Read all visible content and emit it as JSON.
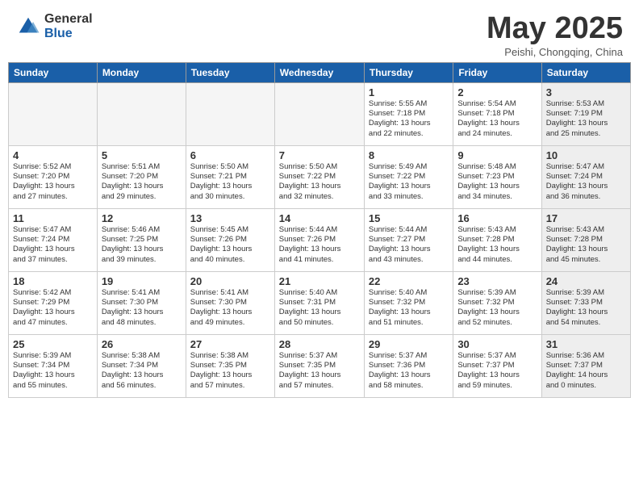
{
  "logo": {
    "general": "General",
    "blue": "Blue"
  },
  "title": {
    "month": "May 2025",
    "location": "Peishi, Chongqing, China"
  },
  "days": [
    "Sunday",
    "Monday",
    "Tuesday",
    "Wednesday",
    "Thursday",
    "Friday",
    "Saturday"
  ],
  "weeks": [
    [
      {
        "day": "",
        "empty": true
      },
      {
        "day": "",
        "empty": true
      },
      {
        "day": "",
        "empty": true
      },
      {
        "day": "",
        "empty": true
      },
      {
        "day": "1",
        "lines": [
          "Sunrise: 5:55 AM",
          "Sunset: 7:18 PM",
          "Daylight: 13 hours",
          "and 22 minutes."
        ]
      },
      {
        "day": "2",
        "lines": [
          "Sunrise: 5:54 AM",
          "Sunset: 7:18 PM",
          "Daylight: 13 hours",
          "and 24 minutes."
        ]
      },
      {
        "day": "3",
        "shaded": true,
        "lines": [
          "Sunrise: 5:53 AM",
          "Sunset: 7:19 PM",
          "Daylight: 13 hours",
          "and 25 minutes."
        ]
      }
    ],
    [
      {
        "day": "4",
        "lines": [
          "Sunrise: 5:52 AM",
          "Sunset: 7:20 PM",
          "Daylight: 13 hours",
          "and 27 minutes."
        ]
      },
      {
        "day": "5",
        "lines": [
          "Sunrise: 5:51 AM",
          "Sunset: 7:20 PM",
          "Daylight: 13 hours",
          "and 29 minutes."
        ]
      },
      {
        "day": "6",
        "lines": [
          "Sunrise: 5:50 AM",
          "Sunset: 7:21 PM",
          "Daylight: 13 hours",
          "and 30 minutes."
        ]
      },
      {
        "day": "7",
        "lines": [
          "Sunrise: 5:50 AM",
          "Sunset: 7:22 PM",
          "Daylight: 13 hours",
          "and 32 minutes."
        ]
      },
      {
        "day": "8",
        "lines": [
          "Sunrise: 5:49 AM",
          "Sunset: 7:22 PM",
          "Daylight: 13 hours",
          "and 33 minutes."
        ]
      },
      {
        "day": "9",
        "lines": [
          "Sunrise: 5:48 AM",
          "Sunset: 7:23 PM",
          "Daylight: 13 hours",
          "and 34 minutes."
        ]
      },
      {
        "day": "10",
        "shaded": true,
        "lines": [
          "Sunrise: 5:47 AM",
          "Sunset: 7:24 PM",
          "Daylight: 13 hours",
          "and 36 minutes."
        ]
      }
    ],
    [
      {
        "day": "11",
        "lines": [
          "Sunrise: 5:47 AM",
          "Sunset: 7:24 PM",
          "Daylight: 13 hours",
          "and 37 minutes."
        ]
      },
      {
        "day": "12",
        "lines": [
          "Sunrise: 5:46 AM",
          "Sunset: 7:25 PM",
          "Daylight: 13 hours",
          "and 39 minutes."
        ]
      },
      {
        "day": "13",
        "lines": [
          "Sunrise: 5:45 AM",
          "Sunset: 7:26 PM",
          "Daylight: 13 hours",
          "and 40 minutes."
        ]
      },
      {
        "day": "14",
        "lines": [
          "Sunrise: 5:44 AM",
          "Sunset: 7:26 PM",
          "Daylight: 13 hours",
          "and 41 minutes."
        ]
      },
      {
        "day": "15",
        "lines": [
          "Sunrise: 5:44 AM",
          "Sunset: 7:27 PM",
          "Daylight: 13 hours",
          "and 43 minutes."
        ]
      },
      {
        "day": "16",
        "lines": [
          "Sunrise: 5:43 AM",
          "Sunset: 7:28 PM",
          "Daylight: 13 hours",
          "and 44 minutes."
        ]
      },
      {
        "day": "17",
        "shaded": true,
        "lines": [
          "Sunrise: 5:43 AM",
          "Sunset: 7:28 PM",
          "Daylight: 13 hours",
          "and 45 minutes."
        ]
      }
    ],
    [
      {
        "day": "18",
        "lines": [
          "Sunrise: 5:42 AM",
          "Sunset: 7:29 PM",
          "Daylight: 13 hours",
          "and 47 minutes."
        ]
      },
      {
        "day": "19",
        "lines": [
          "Sunrise: 5:41 AM",
          "Sunset: 7:30 PM",
          "Daylight: 13 hours",
          "and 48 minutes."
        ]
      },
      {
        "day": "20",
        "lines": [
          "Sunrise: 5:41 AM",
          "Sunset: 7:30 PM",
          "Daylight: 13 hours",
          "and 49 minutes."
        ]
      },
      {
        "day": "21",
        "lines": [
          "Sunrise: 5:40 AM",
          "Sunset: 7:31 PM",
          "Daylight: 13 hours",
          "and 50 minutes."
        ]
      },
      {
        "day": "22",
        "lines": [
          "Sunrise: 5:40 AM",
          "Sunset: 7:32 PM",
          "Daylight: 13 hours",
          "and 51 minutes."
        ]
      },
      {
        "day": "23",
        "lines": [
          "Sunrise: 5:39 AM",
          "Sunset: 7:32 PM",
          "Daylight: 13 hours",
          "and 52 minutes."
        ]
      },
      {
        "day": "24",
        "shaded": true,
        "lines": [
          "Sunrise: 5:39 AM",
          "Sunset: 7:33 PM",
          "Daylight: 13 hours",
          "and 54 minutes."
        ]
      }
    ],
    [
      {
        "day": "25",
        "lines": [
          "Sunrise: 5:39 AM",
          "Sunset: 7:34 PM",
          "Daylight: 13 hours",
          "and 55 minutes."
        ]
      },
      {
        "day": "26",
        "lines": [
          "Sunrise: 5:38 AM",
          "Sunset: 7:34 PM",
          "Daylight: 13 hours",
          "and 56 minutes."
        ]
      },
      {
        "day": "27",
        "lines": [
          "Sunrise: 5:38 AM",
          "Sunset: 7:35 PM",
          "Daylight: 13 hours",
          "and 57 minutes."
        ]
      },
      {
        "day": "28",
        "lines": [
          "Sunrise: 5:37 AM",
          "Sunset: 7:35 PM",
          "Daylight: 13 hours",
          "and 57 minutes."
        ]
      },
      {
        "day": "29",
        "lines": [
          "Sunrise: 5:37 AM",
          "Sunset: 7:36 PM",
          "Daylight: 13 hours",
          "and 58 minutes."
        ]
      },
      {
        "day": "30",
        "lines": [
          "Sunrise: 5:37 AM",
          "Sunset: 7:37 PM",
          "Daylight: 13 hours",
          "and 59 minutes."
        ]
      },
      {
        "day": "31",
        "shaded": true,
        "lines": [
          "Sunrise: 5:36 AM",
          "Sunset: 7:37 PM",
          "Daylight: 14 hours",
          "and 0 minutes."
        ]
      }
    ]
  ]
}
